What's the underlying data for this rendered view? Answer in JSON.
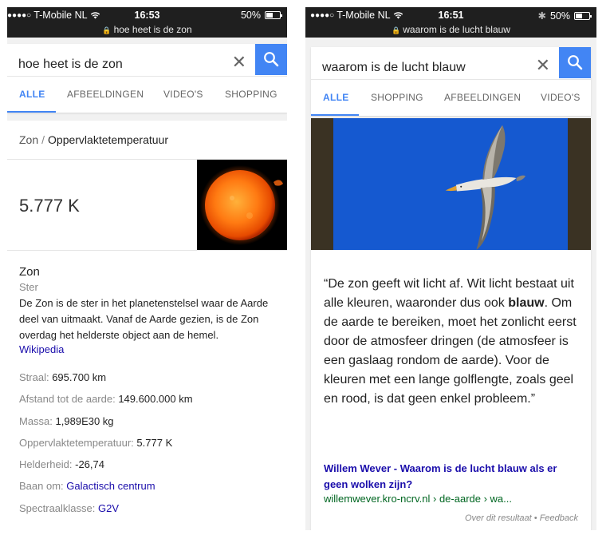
{
  "left": {
    "status": {
      "carrier": "T-Mobile NL",
      "time": "16:53",
      "battery": "50%",
      "battery_level": 0.5,
      "url": "hoe heet is de zon"
    },
    "search": {
      "query": "hoe heet is de zon",
      "clear": "✕"
    },
    "tabs": [
      "ALLE",
      "AFBEELDINGEN",
      "VIDEO'S",
      "SHOPPING"
    ],
    "active_tab": "ALLE",
    "breadcrumb": {
      "parent": "Zon",
      "separator": "/",
      "current": "Oppervlaktetemperatuur"
    },
    "answer": "5.777 K",
    "entity": {
      "title": "Zon",
      "type": "Ster",
      "description": "De Zon is de ster in het planetenstelsel waar de Aarde deel van uitmaakt. Vanaf de Aarde gezien, is de Zon overdag het helderste object aan de hemel.",
      "source": "Wikipedia"
    },
    "facts": [
      {
        "label": "Straal:",
        "value": "695.700 km"
      },
      {
        "label": "Afstand tot de aarde:",
        "value": "149.600.000 km"
      },
      {
        "label": "Massa:",
        "value": "1,989E30 kg"
      },
      {
        "label": "Oppervlaktetemperatuur:",
        "value": "5.777 K"
      },
      {
        "label": "Helderheid:",
        "value": "-26,74"
      },
      {
        "label": "Baan om:",
        "value": "Galactisch centrum"
      },
      {
        "label": "Spectraalklasse:",
        "value": "G2V"
      }
    ]
  },
  "right": {
    "status": {
      "carrier": "T-Mobile NL",
      "time": "16:51",
      "battery": "50%",
      "battery_level": 0.5,
      "url": "waarom is de lucht blauw"
    },
    "search": {
      "query": "waarom is de lucht blauw",
      "clear": "✕"
    },
    "tabs": [
      "ALLE",
      "SHOPPING",
      "AFBEELDINGEN",
      "VIDEO'S"
    ],
    "active_tab": "ALLE",
    "quote_before": "“De zon geeft wit licht af. Wit licht bestaat uit alle kleuren, waaronder dus ook ",
    "quote_bold": "blauw",
    "quote_after": ". Om de aarde te bereiken, moet het zonlicht eerst door de atmosfeer dringen (de atmosfeer is een gaslaag rondom de aarde). Voor de kleuren met een lange golflengte, zoals geel en rood, is dat geen enkel probleem.”",
    "result_title": "Willem Wever - Waarom is de lucht blauw als er geen wolken zijn?",
    "result_url": "willemwever.kro-ncrv.nl › de-aarde › wa...",
    "footer": "Over dit resultaat • Feedback"
  },
  "colors": {
    "accent": "#4285f4",
    "link": "#1a0dab",
    "url_green": "#006621",
    "sky": "#1a5fd6"
  }
}
